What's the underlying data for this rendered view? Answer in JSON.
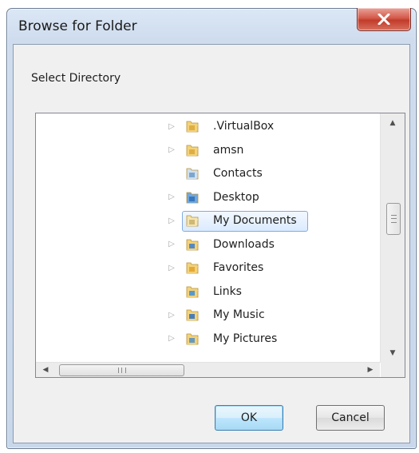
{
  "window": {
    "title": "Browse for Folder",
    "close_label": "X"
  },
  "prompt": "Select Directory",
  "tree": {
    "items": [
      {
        "label": ".VirtualBox",
        "icon": "folder-icon",
        "expandable": true,
        "selected": false
      },
      {
        "label": "amsn",
        "icon": "folder-icon",
        "expandable": true,
        "selected": false
      },
      {
        "label": "Contacts",
        "icon": "contacts-folder-icon",
        "expandable": false,
        "selected": false
      },
      {
        "label": "Desktop",
        "icon": "desktop-folder-icon",
        "expandable": true,
        "selected": false
      },
      {
        "label": "My Documents",
        "icon": "documents-folder-icon",
        "expandable": true,
        "selected": true
      },
      {
        "label": "Downloads",
        "icon": "downloads-folder-icon",
        "expandable": true,
        "selected": false
      },
      {
        "label": "Favorites",
        "icon": "favorites-folder-icon",
        "expandable": true,
        "selected": false
      },
      {
        "label": "Links",
        "icon": "links-folder-icon",
        "expandable": false,
        "selected": false
      },
      {
        "label": "My Music",
        "icon": "music-folder-icon",
        "expandable": true,
        "selected": false
      },
      {
        "label": "My Pictures",
        "icon": "pictures-folder-icon",
        "expandable": true,
        "selected": false
      }
    ]
  },
  "buttons": {
    "ok": "OK",
    "cancel": "Cancel"
  },
  "colors": {
    "selection_border": "#84acdd",
    "ok_border": "#3c7fb1",
    "close_red": "#c23b2a"
  }
}
